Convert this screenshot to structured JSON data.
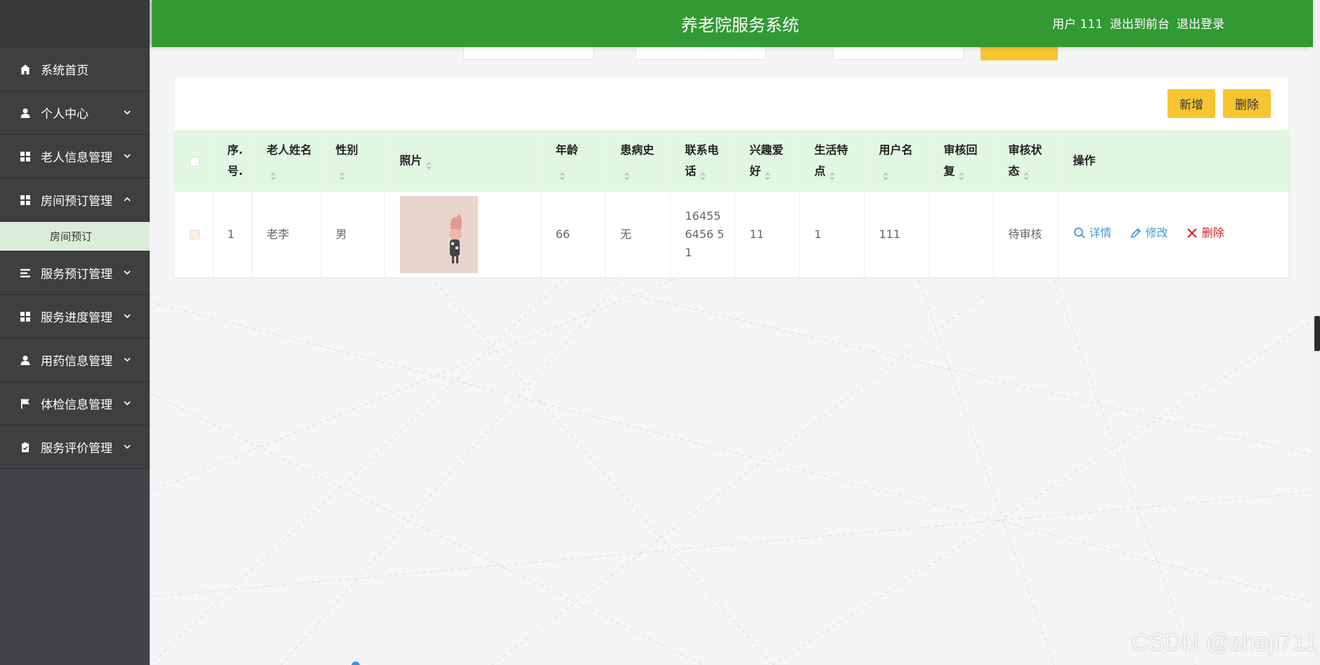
{
  "header": {
    "title": "养老院服务系统",
    "user": "用户 111",
    "to_front": "退出到前台",
    "logout": "退出登录"
  },
  "sidebar": {
    "items": [
      {
        "label": "系统首页",
        "icon": "home-icon",
        "has_arrow": false
      },
      {
        "label": "个人中心",
        "icon": "user-icon",
        "has_arrow": true
      },
      {
        "label": "老人信息管理",
        "icon": "grid-icon",
        "has_arrow": true
      },
      {
        "label": "房间预订管理",
        "icon": "grid-icon",
        "has_arrow": true,
        "expanded": true
      },
      {
        "label": "服务预订管理",
        "icon": "list-icon",
        "has_arrow": true
      },
      {
        "label": "服务进度管理",
        "icon": "grid-icon",
        "has_arrow": true
      },
      {
        "label": "用药信息管理",
        "icon": "user-icon",
        "has_arrow": true
      },
      {
        "label": "体检信息管理",
        "icon": "flag-icon",
        "has_arrow": true
      },
      {
        "label": "服务评价管理",
        "icon": "clipboard-icon",
        "has_arrow": true
      }
    ],
    "submenu": {
      "label": "房间预订"
    }
  },
  "actions": {
    "add": "新增",
    "delete": "删除"
  },
  "table": {
    "headers": {
      "seq": "序.号.",
      "name": "老人姓名",
      "gender": "性别",
      "photo": "照片",
      "age": "年龄",
      "history": "患病史",
      "phone": "联系电话",
      "hobby": "兴趣爱好",
      "habits": "生活特点",
      "username": "用户名",
      "reply": "审核回复",
      "status": "审核状态",
      "ops": "操作"
    },
    "rows": [
      {
        "seq": "1",
        "name": "老李",
        "gender": "男",
        "age": "66",
        "history": "无",
        "phone": "164556456 51",
        "hobby": "11",
        "habits": "1",
        "username": "111",
        "reply": "",
        "status": "待审核"
      }
    ],
    "ops": {
      "detail": "详情",
      "edit": "修改",
      "delete": "删除"
    }
  },
  "watermark": "CSDN @sheji711"
}
